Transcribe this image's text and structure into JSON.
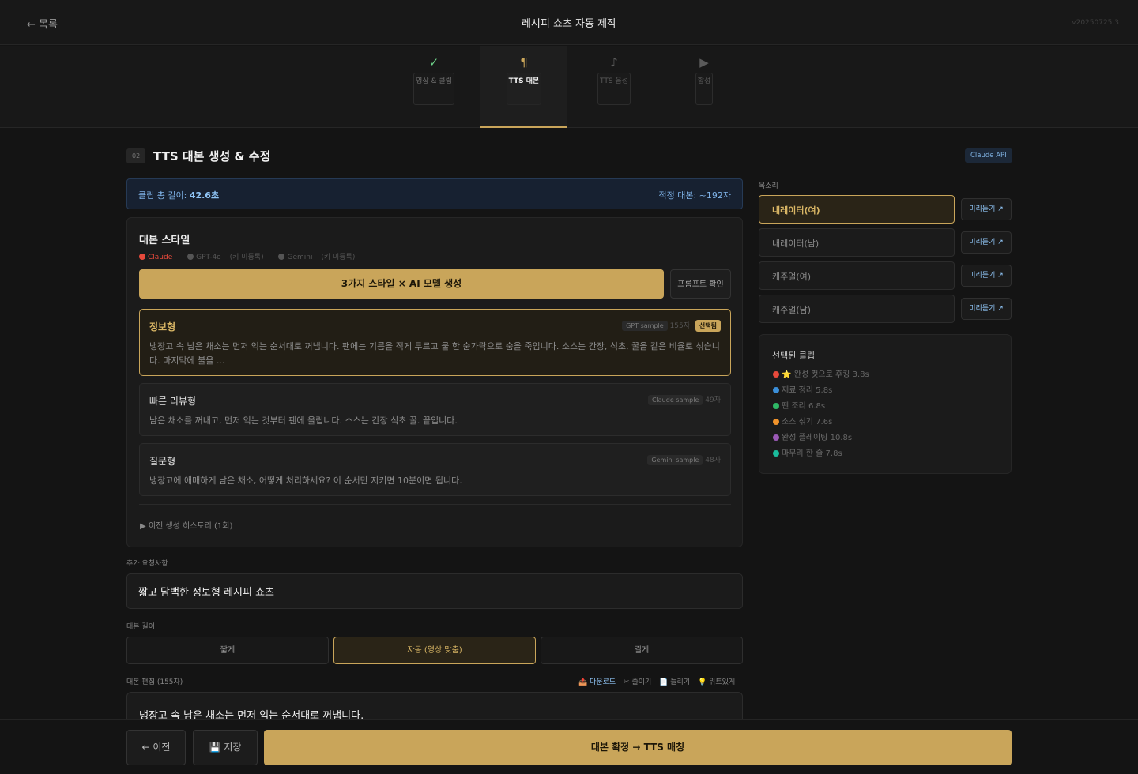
{
  "header": {
    "back_label": "← 목록",
    "title": "레시피 쇼츠 자동 제작",
    "version": "v20250725.3"
  },
  "steps": [
    {
      "icon": "✓",
      "label": "영상 & 클립",
      "state": "done"
    },
    {
      "icon": "¶",
      "label": "TTS 대본",
      "state": "active"
    },
    {
      "icon": "♪",
      "label": "TTS 음성",
      "state": "pending"
    },
    {
      "icon": "▶",
      "label": "합성",
      "state": "pending"
    }
  ],
  "section": {
    "number": "02",
    "title": "TTS 대본 생성 & 수정",
    "api_badge": "Claude API"
  },
  "info": {
    "clip_length_label": "클립 총 길이:",
    "clip_length_value": "42.6초",
    "recommended": "적정 대본: ~192자"
  },
  "style_panel": {
    "title": "대본 스타일",
    "models": [
      {
        "name": "Claude",
        "color": "#e84a3c",
        "status": ""
      },
      {
        "name": "GPT-4o",
        "color": "#555555",
        "status": "(키 미등록)"
      },
      {
        "name": "Gemini",
        "color": "#555555",
        "status": "(키 미등록)"
      }
    ],
    "generate_label": "3가지 스타일 × AI 모델 생성",
    "prompt_label": "프롬프트 확인",
    "cards": [
      {
        "title": "정보형",
        "tag": "GPT sample",
        "count": "155자",
        "selected_label": "선택됨",
        "text": "냉장고 속 남은 채소는 먼저 익는 순서대로 꺼냅니다. 팬에는 기름을 적게 두르고 물 한 숟가락으로 숨을 죽입니다. 소스는 간장, 식초, 꿀을 같은 비율로 섞습니다. 마지막에 불을 ..."
      },
      {
        "title": "빠른 리뷰형",
        "tag": "Claude sample",
        "count": "49자",
        "text": "남은 채소를 꺼내고, 먼저 익는 것부터 팬에 올립니다. 소스는 간장 식초 꿀. 끝입니다."
      },
      {
        "title": "질문형",
        "tag": "Gemini sample",
        "count": "48자",
        "text": "냉장고에 애매하게 남은 채소, 어떻게 처리하세요? 이 순서만 지키면 10분이면 됩니다."
      }
    ],
    "history_label": "▶ 이전 생성 히스토리 (1회)"
  },
  "extra_request": {
    "label": "추가 요청사항",
    "value": "짧고 담백한 정보형 레시피 쇼츠"
  },
  "length": {
    "label": "대본 길이",
    "options": [
      "짧게",
      "자동 (영상 맞춤)",
      "길게"
    ],
    "selected": 1
  },
  "editor": {
    "label": "대본 편집 (155자)",
    "tools": {
      "download": "📥 다운로드",
      "shorten": "✂ 줄이기",
      "lengthen": "📄 늘리기",
      "witty": "💡 위트있게"
    },
    "text": "냉장고 속 남은 채소는 먼저 익는 순서대로 꺼냅니다."
  },
  "footer": {
    "prev_label": "← 이전",
    "save_label": "💾 저장",
    "confirm_label": "대본 확정 → TTS 매칭"
  },
  "voice": {
    "label": "목소리",
    "preview_label": "미리듣기 ↗",
    "options": [
      "내레이터(여)",
      "내레이터(남)",
      "캐주얼(여)",
      "캐주얼(남)"
    ],
    "selected": 0
  },
  "clips": {
    "title": "선택된 클립",
    "items": [
      {
        "name": "⭐ 완성 컷으로 후킹",
        "duration": "3.8s",
        "color": "#e84a3c"
      },
      {
        "name": "재료 정리",
        "duration": "5.8s",
        "color": "#3b8fd9"
      },
      {
        "name": "팬 조리",
        "duration": "6.8s",
        "color": "#2fb866"
      },
      {
        "name": "소스 섞기",
        "duration": "7.6s",
        "color": "#f0932b"
      },
      {
        "name": "완성 플레이팅",
        "duration": "10.8s",
        "color": "#9b59b6"
      },
      {
        "name": "마무리 한 줄",
        "duration": "7.8s",
        "color": "#1abc9c"
      }
    ]
  }
}
